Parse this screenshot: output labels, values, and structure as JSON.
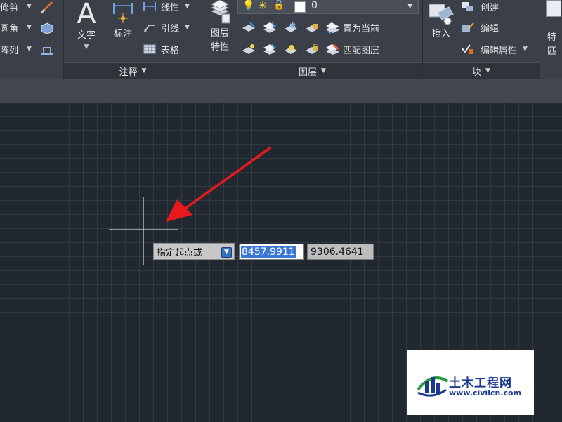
{
  "ribbon": {
    "modify_partial": {
      "items": [
        "修剪",
        "圆角",
        "阵列"
      ]
    },
    "annotation": {
      "title": "注释",
      "text_label": "文字",
      "dim_label": "标注",
      "linear_label": "线性",
      "leader_label": "引线",
      "table_label": "表格"
    },
    "layers": {
      "title": "图层",
      "layer_props_line1": "图层",
      "layer_props_line2": "特性",
      "current_layer": "0",
      "set_current_label": "置为当前",
      "match_layer_label": "匹配图层"
    },
    "block": {
      "title": "块",
      "insert_label": "插入",
      "create_label": "创建",
      "edit_label": "编辑",
      "edit_attr_label": "编辑属性"
    },
    "props_partial": {
      "line1": "特",
      "line2": "匹"
    }
  },
  "dynamic_input": {
    "prompt": "指定起点或",
    "x_value": "8457.9911",
    "y_value": "9306.4641"
  },
  "watermark": {
    "name": "土木工程网",
    "url": "www.civilcn.com"
  },
  "colors": {
    "ribbon_bg": "#3b4048",
    "canvas_bg": "#212830",
    "arrow": "#e8191c",
    "highlight": "#3a78d8"
  }
}
